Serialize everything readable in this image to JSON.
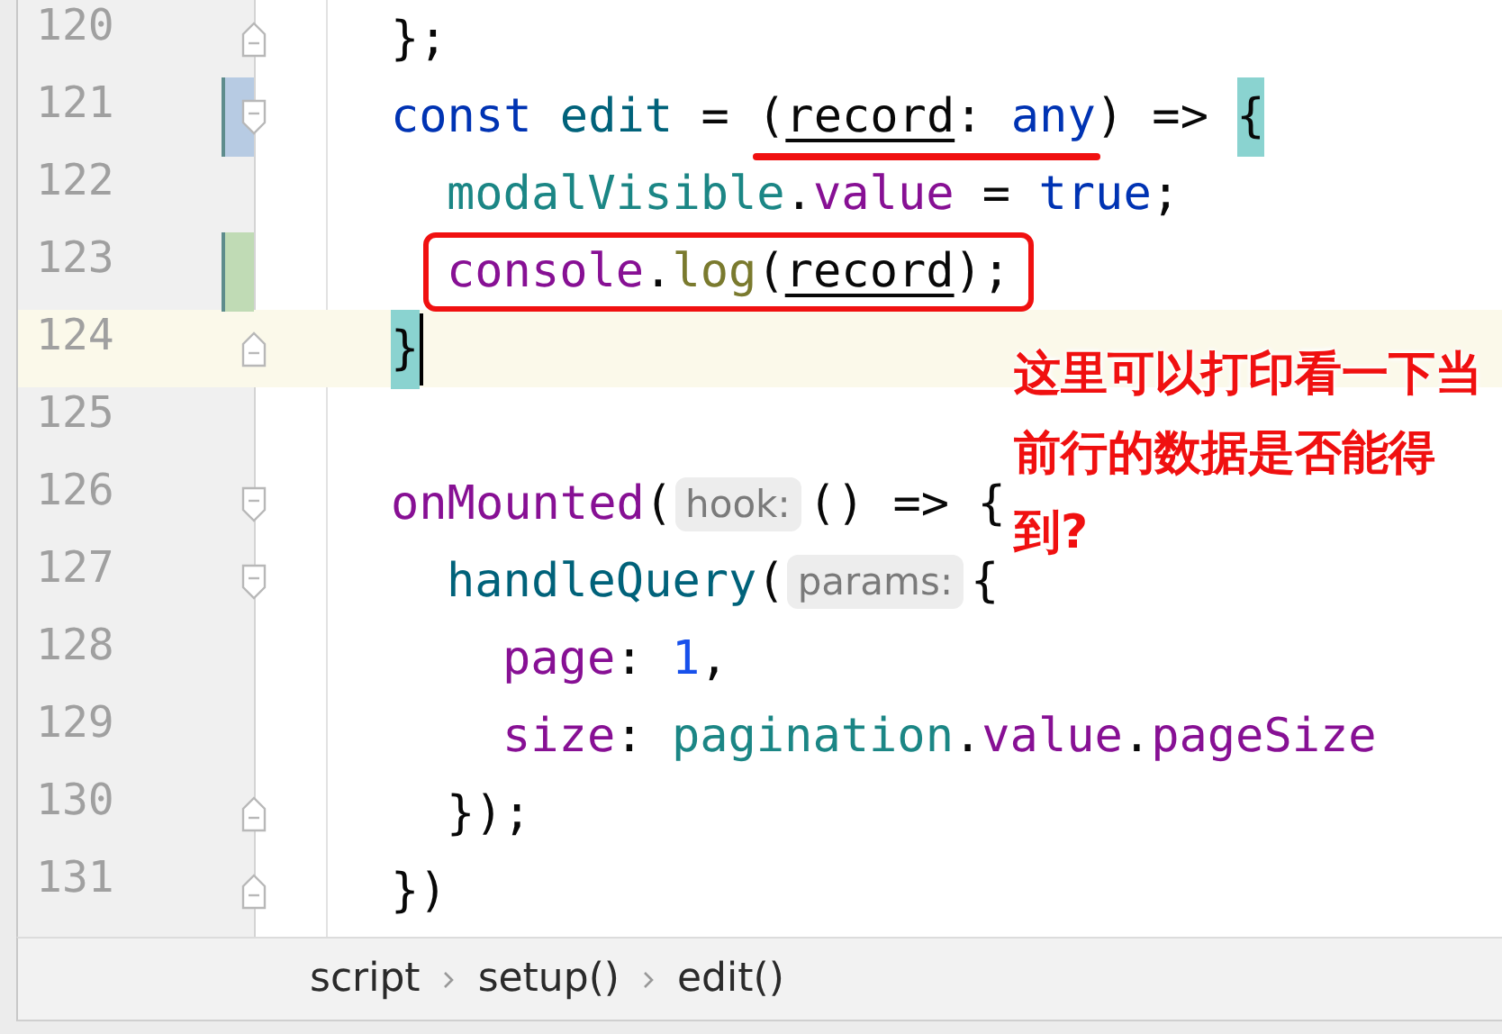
{
  "editor": {
    "lines": [
      {
        "number": "120",
        "fold": {
          "kind": "end"
        },
        "current": false,
        "segments": [
          {
            "kind": "code",
            "parts": [
              {
                "kind": "plain",
                "text": "};"
              }
            ]
          }
        ]
      },
      {
        "number": "121",
        "fold": {
          "kind": "start"
        },
        "change": {
          "kind": "modified"
        },
        "current": false,
        "segments": [
          {
            "kind": "code",
            "parts": [
              {
                "kind": "keyword",
                "text": "const "
              },
              {
                "kind": "func",
                "text": "edit"
              },
              {
                "kind": "plain",
                "text": " = "
              }
            ]
          },
          {
            "kind": "code",
            "annotation": {
              "kind": "underline"
            },
            "parts": [
              {
                "kind": "plain",
                "text": "("
              },
              {
                "kind": "param",
                "text": "record"
              },
              {
                "kind": "plain",
                "text": ": "
              },
              {
                "kind": "keyword",
                "text": "any"
              }
            ]
          },
          {
            "kind": "code",
            "parts": [
              {
                "kind": "plain",
                "text": ") => "
              },
              {
                "kind": "match",
                "text": "{"
              }
            ]
          }
        ],
        "children": [
          {
            "number": "122",
            "current": false,
            "segments": [
              {
                "kind": "code",
                "parts": [
                  {
                    "kind": "local",
                    "text": "modalVisible"
                  },
                  {
                    "kind": "plain",
                    "text": "."
                  },
                  {
                    "kind": "field",
                    "text": "value"
                  },
                  {
                    "kind": "plain",
                    "text": " = "
                  },
                  {
                    "kind": "keyword",
                    "text": "true"
                  },
                  {
                    "kind": "plain",
                    "text": ";"
                  }
                ]
              }
            ]
          },
          {
            "number": "123",
            "change": {
              "kind": "added"
            },
            "current": false,
            "segments": [
              {
                "kind": "code",
                "annotation": {
                  "kind": "box"
                },
                "parts": [
                  {
                    "kind": "field",
                    "text": "console"
                  },
                  {
                    "kind": "plain",
                    "text": "."
                  },
                  {
                    "kind": "method",
                    "text": "log"
                  },
                  {
                    "kind": "plain",
                    "text": "("
                  },
                  {
                    "kind": "param",
                    "text": "record"
                  },
                  {
                    "kind": "plain",
                    "text": ");"
                  }
                ]
              }
            ]
          }
        ]
      },
      {
        "number": "124",
        "fold": {
          "kind": "end"
        },
        "current": true,
        "segments": [
          {
            "kind": "code",
            "parts": [
              {
                "kind": "match",
                "text": "}"
              }
            ]
          }
        ]
      },
      {
        "number": "125",
        "current": false
      },
      {
        "number": "126",
        "fold": {
          "kind": "start"
        },
        "current": false,
        "segments": [
          {
            "kind": "code",
            "parts": [
              {
                "kind": "field",
                "text": "onMounted"
              },
              {
                "kind": "plain",
                "text": "("
              }
            ]
          },
          {
            "kind": "hint",
            "text": "hook:"
          },
          {
            "kind": "code",
            "parts": [
              {
                "kind": "plain",
                "text": "() => {"
              }
            ]
          }
        ],
        "children": [
          {
            "number": "127",
            "fold": {
              "kind": "start"
            },
            "current": false,
            "segments": [
              {
                "kind": "code",
                "parts": [
                  {
                    "kind": "func",
                    "text": "handleQuery"
                  },
                  {
                    "kind": "plain",
                    "text": "("
                  }
                ]
              },
              {
                "kind": "hint",
                "text": "params:"
              },
              {
                "kind": "code",
                "parts": [
                  {
                    "kind": "plain",
                    "text": "{"
                  }
                ]
              }
            ],
            "children": [
              {
                "number": "128",
                "current": false,
                "segments": [
                  {
                    "kind": "code",
                    "parts": [
                      {
                        "kind": "field",
                        "text": "page"
                      },
                      {
                        "kind": "plain",
                        "text": ": "
                      },
                      {
                        "kind": "number",
                        "text": "1"
                      },
                      {
                        "kind": "plain",
                        "text": ","
                      }
                    ]
                  }
                ]
              },
              {
                "number": "129",
                "current": false,
                "segments": [
                  {
                    "kind": "code",
                    "parts": [
                      {
                        "kind": "field",
                        "text": "size"
                      },
                      {
                        "kind": "plain",
                        "text": ": "
                      },
                      {
                        "kind": "local",
                        "text": "pagination"
                      },
                      {
                        "kind": "plain",
                        "text": "."
                      },
                      {
                        "kind": "field",
                        "text": "value"
                      },
                      {
                        "kind": "plain",
                        "text": "."
                      },
                      {
                        "kind": "field",
                        "text": "pageSize"
                      }
                    ]
                  }
                ]
              }
            ]
          },
          {
            "number": "130",
            "fold": {
              "kind": "end"
            },
            "current": false,
            "segments": [
              {
                "kind": "code",
                "parts": [
                  {
                    "kind": "plain",
                    "text": "});"
                  }
                ]
              }
            ]
          }
        ]
      },
      {
        "number": "131",
        "fold": {
          "kind": "end"
        },
        "current": false,
        "segments": [
          {
            "kind": "code",
            "parts": [
              {
                "kind": "plain",
                "text": "})"
              }
            ]
          }
        ]
      }
    ]
  },
  "callout": {
    "text": "这里可以打印看一下当前行的数据是否能得到?"
  },
  "breadcrumb": {
    "items": [
      "script",
      "setup()",
      "edit()"
    ]
  }
}
